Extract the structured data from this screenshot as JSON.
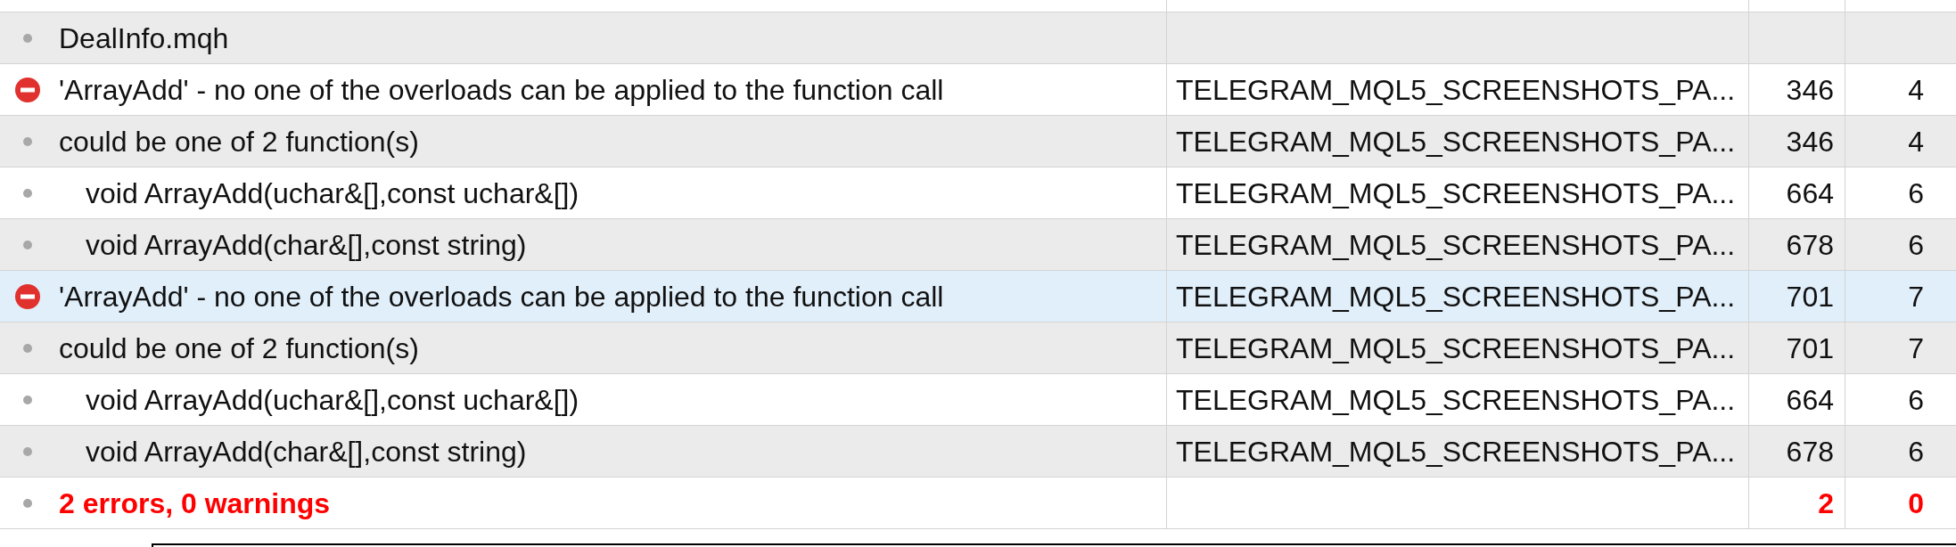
{
  "rows": [
    {
      "kind": "file",
      "text": "DealInfo.mqh",
      "file": "",
      "line": "",
      "column": ""
    },
    {
      "kind": "error",
      "text": "'ArrayAdd' - no one of the overloads can be applied to the function call",
      "file": "TELEGRAM_MQL5_SCREENSHOTS_PA...",
      "line": "346",
      "column": "4",
      "selected": false
    },
    {
      "kind": "info",
      "text": "could be one of 2 function(s)",
      "file": "TELEGRAM_MQL5_SCREENSHOTS_PA...",
      "line": "346",
      "column": "4",
      "children": [
        {
          "kind": "info",
          "text": "void ArrayAdd(uchar&[],const uchar&[])",
          "file": "TELEGRAM_MQL5_SCREENSHOTS_PA...",
          "line": "664",
          "column": "6"
        },
        {
          "kind": "info",
          "text": "void ArrayAdd(char&[],const string)",
          "file": "TELEGRAM_MQL5_SCREENSHOTS_PA...",
          "line": "678",
          "column": "6"
        }
      ]
    },
    {
      "kind": "error",
      "text": "'ArrayAdd' - no one of the overloads can be applied to the function call",
      "file": "TELEGRAM_MQL5_SCREENSHOTS_PA...",
      "line": "701",
      "column": "7",
      "selected": true
    },
    {
      "kind": "info",
      "text": "could be one of 2 function(s)",
      "file": "TELEGRAM_MQL5_SCREENSHOTS_PA...",
      "line": "701",
      "column": "7",
      "children": [
        {
          "kind": "info",
          "text": "void ArrayAdd(uchar&[],const uchar&[])",
          "file": "TELEGRAM_MQL5_SCREENSHOTS_PA...",
          "line": "664",
          "column": "6"
        },
        {
          "kind": "info",
          "text": "void ArrayAdd(char&[],const string)",
          "file": "TELEGRAM_MQL5_SCREENSHOTS_PA...",
          "line": "678",
          "column": "6"
        }
      ]
    },
    {
      "kind": "summary",
      "text": "2 errors, 0 warnings",
      "file": "",
      "line": "2",
      "column": "0"
    }
  ]
}
